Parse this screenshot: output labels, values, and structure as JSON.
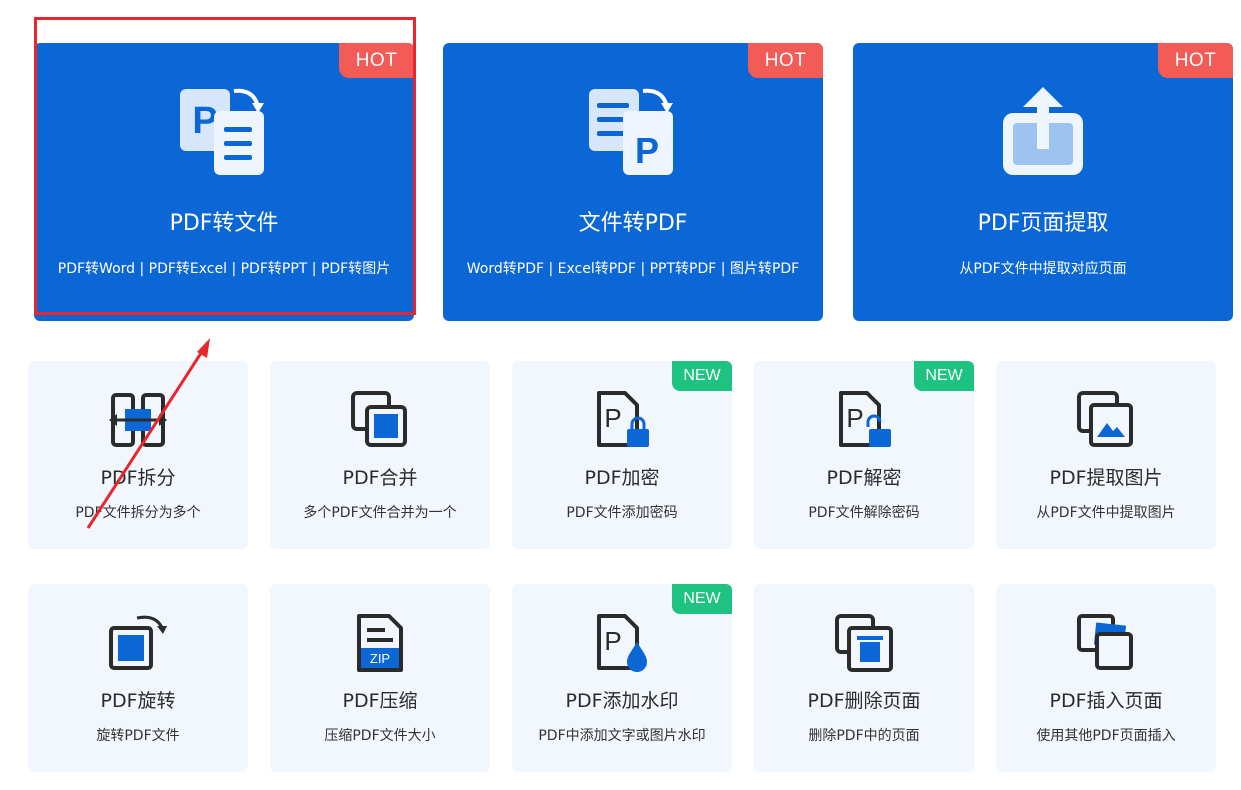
{
  "colors": {
    "hero_bg": "#0b67d6",
    "hot_badge": "#f35b57",
    "new_badge": "#1ec281",
    "tile_bg": "#f1f7fd",
    "annotation_red": "#e8262d"
  },
  "hero_cards": [
    {
      "title": "PDF转文件",
      "desc": "PDF转Word | PDF转Excel | PDF转PPT | PDF转图片",
      "badge": "HOT",
      "icon": "pdf-to-file-icon"
    },
    {
      "title": "文件转PDF",
      "desc": "Word转PDF | Excel转PDF | PPT转PDF | 图片转PDF",
      "badge": "HOT",
      "icon": "file-to-pdf-icon"
    },
    {
      "title": "PDF页面提取",
      "desc": "从PDF文件中提取对应页面",
      "badge": "HOT",
      "icon": "page-extract-icon"
    }
  ],
  "tools": [
    {
      "title": "PDF拆分",
      "desc": "PDF文件拆分为多个",
      "badge": "",
      "icon": "split-icon"
    },
    {
      "title": "PDF合并",
      "desc": "多个PDF文件合并为一个",
      "badge": "",
      "icon": "merge-icon"
    },
    {
      "title": "PDF加密",
      "desc": "PDF文件添加密码",
      "badge": "NEW",
      "icon": "lock-icon"
    },
    {
      "title": "PDF解密",
      "desc": "PDF文件解除密码",
      "badge": "NEW",
      "icon": "unlock-icon"
    },
    {
      "title": "PDF提取图片",
      "desc": "从PDF文件中提取图片",
      "badge": "",
      "icon": "image-extract-icon"
    },
    {
      "title": "PDF旋转",
      "desc": "旋转PDF文件",
      "badge": "",
      "icon": "rotate-icon"
    },
    {
      "title": "PDF压缩",
      "desc": "压缩PDF文件大小",
      "badge": "",
      "icon": "zip-icon",
      "icon_text": "ZIP"
    },
    {
      "title": "PDF添加水印",
      "desc": "PDF中添加文字或图片水印",
      "badge": "NEW",
      "icon": "watermark-icon"
    },
    {
      "title": "PDF删除页面",
      "desc": "删除PDF中的页面",
      "badge": "",
      "icon": "delete-page-icon"
    },
    {
      "title": "PDF插入页面",
      "desc": "使用其他PDF页面插入",
      "badge": "",
      "icon": "insert-page-icon"
    }
  ]
}
